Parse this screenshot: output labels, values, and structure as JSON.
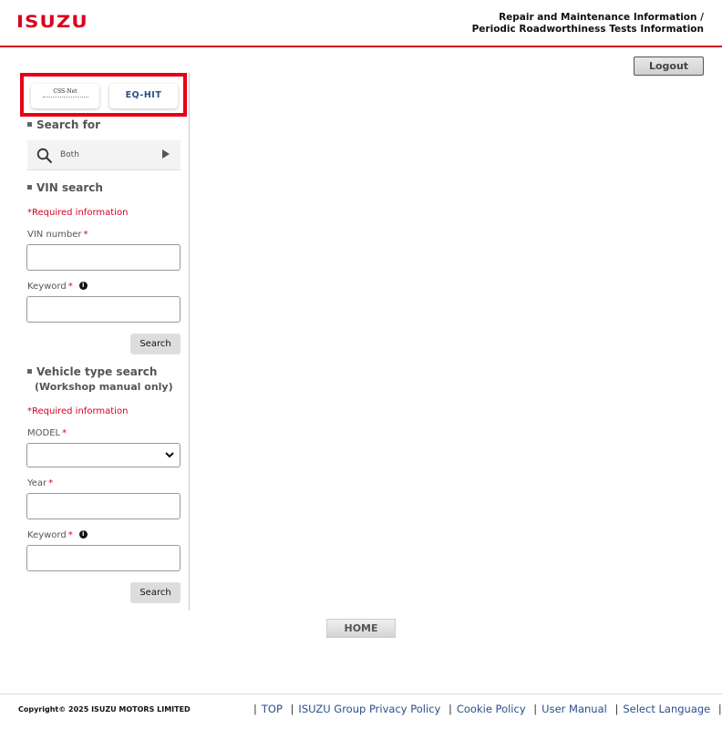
{
  "header": {
    "logo": "ISUZU",
    "title_line1": "Repair and Maintenance Information /",
    "title_line2": "Periodic Roadworthiness Tests Information",
    "logout_label": "Logout"
  },
  "tools": {
    "css_net_label": "CSS-Net",
    "eq_hit_label": "EQ-HIT"
  },
  "search_for": {
    "heading": "Search for",
    "value": "Both"
  },
  "vin_search": {
    "heading": "VIN search",
    "required_note": "*Required information",
    "vin_label": "VIN number",
    "vin_value": "",
    "keyword_label": "Keyword",
    "keyword_value": "",
    "required_mark": "*",
    "info_mark": "i",
    "search_label": "Search"
  },
  "vehicle_search": {
    "heading": "Vehicle type search",
    "subheading": "(Workshop manual only)",
    "required_note": "*Required information",
    "model_label": "MODEL",
    "model_value": "",
    "year_label": "Year",
    "year_value": "",
    "keyword_label": "Keyword",
    "keyword_value": "",
    "required_mark": "*",
    "info_mark": "i",
    "search_label": "Search"
  },
  "home_label": "HOME",
  "footer": {
    "copyright": "Copyright© 2025 ISUZU MOTORS LIMITED",
    "links": [
      "TOP",
      "ISUZU Group Privacy Policy",
      "Cookie Policy",
      "User Manual",
      "Select Language"
    ],
    "separator": "|"
  },
  "colors": {
    "brand_red": "#d8001f",
    "link_blue": "#2a4e8a"
  }
}
